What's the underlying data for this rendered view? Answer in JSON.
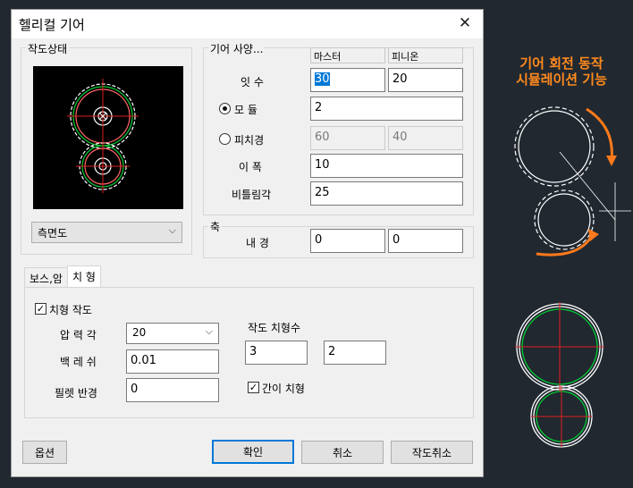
{
  "dialog": {
    "title": "헬리컬 기어",
    "close_glyph": "✕"
  },
  "draw_state": {
    "label": "작도상태",
    "view_select": "측면도"
  },
  "gear_spec": {
    "label": "기어 사양...",
    "col_master": "마스터",
    "col_pinion": "피니온",
    "teeth": {
      "label": "잇 수",
      "master": "30",
      "pinion": "20"
    },
    "module": {
      "label": "모 듈",
      "value": "2"
    },
    "pitch": {
      "label": "피치경",
      "master": "60",
      "pinion": "40"
    },
    "face_width": {
      "label": "이 폭",
      "value": "10"
    },
    "helix_angle": {
      "label": "비틀림각",
      "value": "25"
    }
  },
  "shaft": {
    "label": "축",
    "bore_label": "내 경",
    "master": "0",
    "pinion": "0"
  },
  "tabs": [
    {
      "label": "보스,암"
    },
    {
      "label": "치 형"
    }
  ],
  "tooth": {
    "draw_tooth": "치형 작도",
    "pressure_angle": {
      "label": "압 력 각",
      "value": "20"
    },
    "backlash": {
      "label": "백 레 쉬",
      "value": "0.01"
    },
    "fillet": {
      "label": "필렛 반경",
      "value": "0"
    },
    "draw_count_label": "작도 치형수",
    "draw_count_master": "3",
    "draw_count_pinion": "2",
    "simple_tooth": "간이 치형"
  },
  "buttons": {
    "options": "옵션",
    "ok": "확인",
    "cancel": "취소",
    "draw_cancel": "작도취소"
  },
  "side_caption": {
    "line1": "기어 회전 동작",
    "line2": "시뮬레이션 기능"
  }
}
